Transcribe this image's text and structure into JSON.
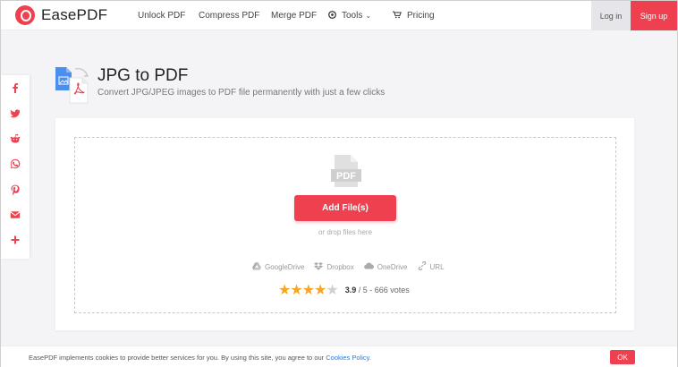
{
  "brand": {
    "name": "EasePDF",
    "color": "#ef4050"
  },
  "nav": {
    "unlock": "Unlock PDF",
    "compress": "Compress PDF",
    "merge": "Merge PDF",
    "tools": "Tools",
    "pricing": "Pricing",
    "login": "Log in",
    "signup": "Sign up"
  },
  "social": [
    "facebook-icon",
    "twitter-icon",
    "reddit-icon",
    "whatsapp-icon",
    "pinterest-icon",
    "email-icon",
    "share-plus-icon"
  ],
  "page": {
    "title": "JPG to PDF",
    "subtitle": "Convert JPG/JPEG images to PDF file permanently with just a few clicks"
  },
  "upload": {
    "pdf_label": "PDF",
    "add_button": "Add File(s)",
    "drop_hint": "or drop files here",
    "sources": {
      "googledrive": "GoogleDrive",
      "dropbox": "Dropbox",
      "onedrive": "OneDrive",
      "url": "URL"
    }
  },
  "rating": {
    "score": "3.9",
    "rest": " / 5 - 666 votes",
    "stars_filled": 4,
    "stars_total": 5
  },
  "cookie": {
    "text": "EasePDF implements cookies to provide better services for you. By using this site, you agree to our ",
    "link": "Cookies Policy",
    "end": ".",
    "ok": "OK"
  }
}
